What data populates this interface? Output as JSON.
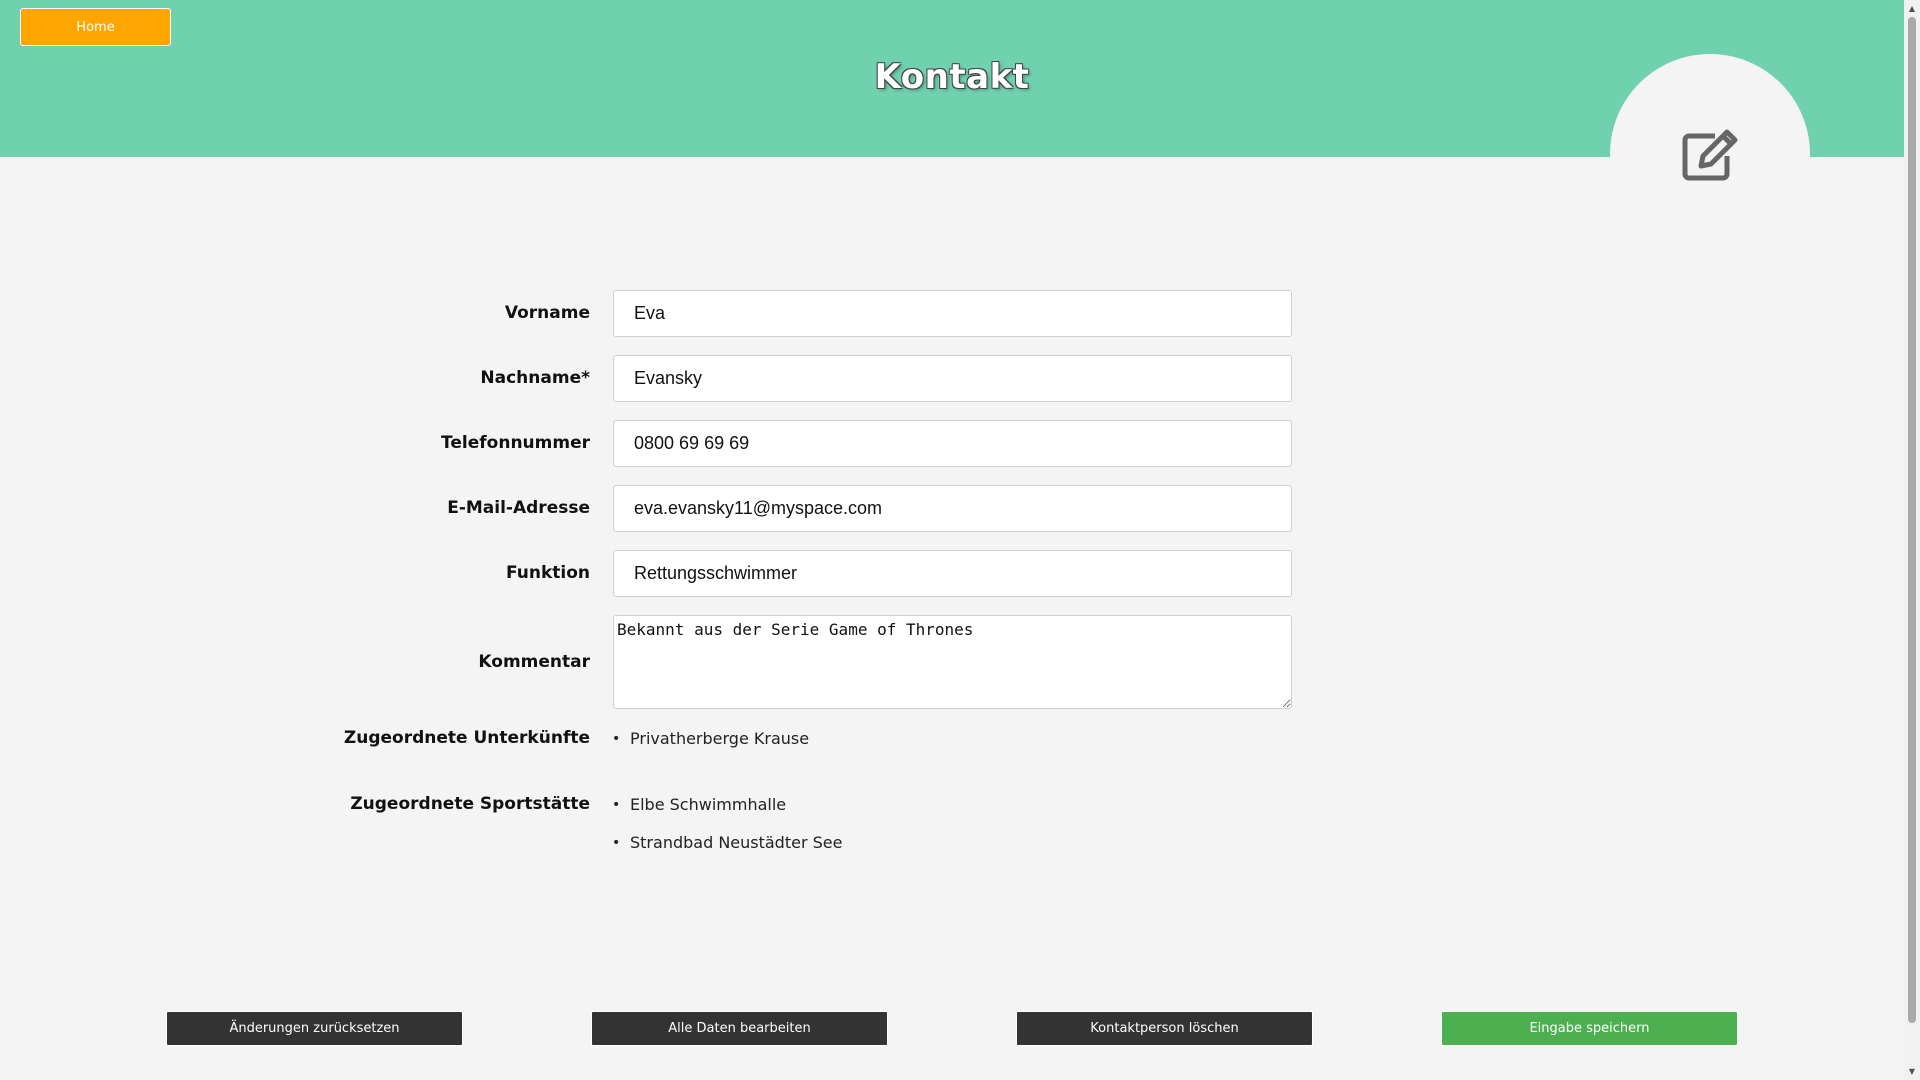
{
  "nav": {
    "home_label": "Home"
  },
  "page": {
    "title": "Kontakt"
  },
  "form": {
    "vorname": {
      "label": "Vorname",
      "value": "Eva"
    },
    "nachname": {
      "label": "Nachname*",
      "value": "Evansky"
    },
    "telefon": {
      "label": "Telefonnummer",
      "value": "0800 69 69 69"
    },
    "email": {
      "label": "E-Mail-Adresse",
      "value": "eva.evansky11@myspace.com"
    },
    "funktion": {
      "label": "Funktion",
      "value": "Rettungsschwimmer"
    },
    "kommentar": {
      "label": "Kommentar",
      "value": "Bekannt aus der Serie Game of Thrones"
    }
  },
  "unterkuenfte": {
    "label": "Zugeordnete Unterkünfte",
    "items": [
      "Privatherberge Krause"
    ]
  },
  "sportstaetten": {
    "label": "Zugeordnete Sportstätte",
    "items": [
      "Elbe Schwimmhalle",
      "Strandbad Neustädter See"
    ]
  },
  "actions": {
    "reset_label": "Änderungen zurücksetzen",
    "edit_all_label": "Alle Daten bearbeiten",
    "delete_label": "Kontaktperson löschen",
    "save_label": "Eingabe speichern"
  },
  "icons": {
    "avatar": "edit-icon",
    "scroll_up": "arrow-up-icon",
    "scroll_down": "arrow-down-icon"
  },
  "colors": {
    "header": "#6fd1ae",
    "home_button": "#ffa500",
    "dark_button": "#333333",
    "save_button": "#4caf50",
    "background": "#f4f4f4"
  }
}
